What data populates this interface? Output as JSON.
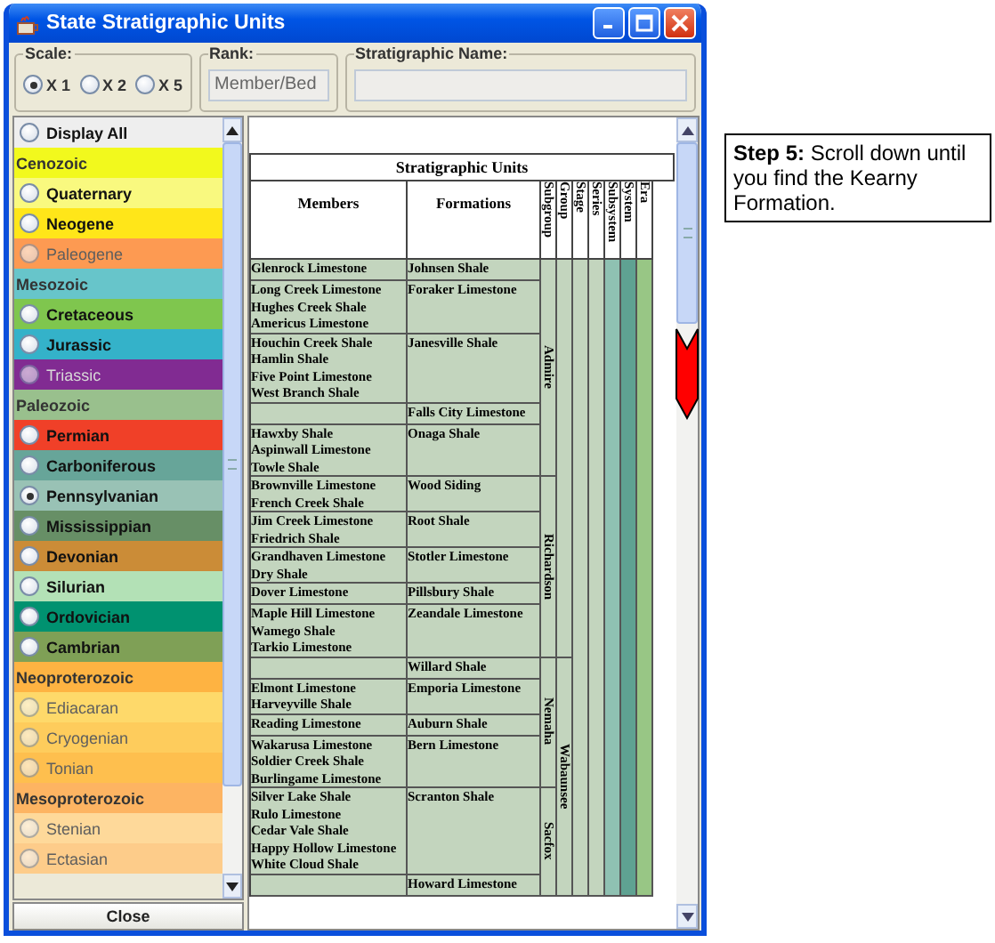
{
  "window": {
    "title": "State Stratigraphic Units"
  },
  "scale": {
    "label": "Scale:",
    "options": [
      {
        "label": "X 1",
        "selected": true
      },
      {
        "label": "X 2",
        "selected": false
      },
      {
        "label": "X 5",
        "selected": false
      }
    ]
  },
  "rank": {
    "label": "Rank:",
    "value": "Member/Bed"
  },
  "strat_name": {
    "label": "Stratigraphic Name:"
  },
  "units_list": [
    {
      "kind": "option",
      "label": "Display All",
      "color": "#eeeeee",
      "selected": false,
      "disabled": false
    },
    {
      "kind": "header",
      "label": "Cenozoic",
      "color": "#f2f91d"
    },
    {
      "kind": "option",
      "label": "Quaternary",
      "color": "#f9f97f",
      "selected": false,
      "disabled": false
    },
    {
      "kind": "option",
      "label": "Neogene",
      "color": "#ffe619",
      "selected": false,
      "disabled": false
    },
    {
      "kind": "option",
      "label": "Paleogene",
      "color": "#fd9a52",
      "selected": false,
      "disabled": true
    },
    {
      "kind": "header",
      "label": "Mesozoic",
      "color": "#67c5ca"
    },
    {
      "kind": "option",
      "label": "Cretaceous",
      "color": "#7fc64e",
      "selected": false,
      "disabled": false
    },
    {
      "kind": "option",
      "label": "Jurassic",
      "color": "#34b2c9",
      "selected": false,
      "disabled": false
    },
    {
      "kind": "option",
      "label": "Triassic",
      "color": "#812b92",
      "selected": false,
      "disabled": true
    },
    {
      "kind": "header",
      "label": "Paleozoic",
      "color": "#99c08d"
    },
    {
      "kind": "option",
      "label": "Permian",
      "color": "#f04028",
      "selected": false,
      "disabled": false
    },
    {
      "kind": "option",
      "label": "Carboniferous",
      "color": "#67a599",
      "selected": false,
      "disabled": false
    },
    {
      "kind": "option",
      "label": "Pennsylvanian",
      "color": "#99c2b5",
      "selected": true,
      "disabled": false
    },
    {
      "kind": "option",
      "label": "Mississippian",
      "color": "#678f66",
      "selected": false,
      "disabled": false
    },
    {
      "kind": "option",
      "label": "Devonian",
      "color": "#cb8c37",
      "selected": false,
      "disabled": false
    },
    {
      "kind": "option",
      "label": "Silurian",
      "color": "#b3e1b6",
      "selected": false,
      "disabled": false
    },
    {
      "kind": "option",
      "label": "Ordovician",
      "color": "#009270",
      "selected": false,
      "disabled": false
    },
    {
      "kind": "option",
      "label": "Cambrian",
      "color": "#7fa056",
      "selected": false,
      "disabled": false
    },
    {
      "kind": "header",
      "label": "Neoproterozoic",
      "color": "#feb342"
    },
    {
      "kind": "option",
      "label": "Ediacaran",
      "color": "#fed96a",
      "selected": false,
      "disabled": true
    },
    {
      "kind": "option",
      "label": "Cryogenian",
      "color": "#fecc5c",
      "selected": false,
      "disabled": true
    },
    {
      "kind": "option",
      "label": "Tonian",
      "color": "#febf4e",
      "selected": false,
      "disabled": true
    },
    {
      "kind": "header",
      "label": "Mesoproterozoic",
      "color": "#fdb462"
    },
    {
      "kind": "option",
      "label": "Stenian",
      "color": "#fed99a",
      "selected": false,
      "disabled": true
    },
    {
      "kind": "option",
      "label": "Ectasian",
      "color": "#fdcc8a",
      "selected": false,
      "disabled": true
    }
  ],
  "close_button": "Close",
  "chart": {
    "title": "Stratigraphic Units",
    "columns": [
      "Members",
      "Formations",
      "Subgroup",
      "Group",
      "Stage",
      "Series",
      "Subsystem",
      "System",
      "Era"
    ],
    "groups": [
      {
        "subgroups": [
          {
            "name": "Admire",
            "formations": [
              {
                "name": "Johnsen Shale",
                "members": [
                  "Glenrock Limestone"
                ]
              },
              {
                "name": "Foraker Limestone",
                "members": [
                  "Long Creek Limestone",
                  "Hughes Creek Shale",
                  "Americus Limestone"
                ]
              },
              {
                "name": "Janesville Shale",
                "members": [
                  "Houchin Creek Shale",
                  "Hamlin Shale",
                  "Five Point Limestone",
                  "West Branch Shale"
                ]
              },
              {
                "name": "Falls City Limestone"
              },
              {
                "name": "Onaga Shale",
                "members": [
                  "Hawxby Shale",
                  "Aspinwall Limestone",
                  "Towle Shale"
                ]
              }
            ]
          },
          {
            "name": "Richardson",
            "formations": [
              {
                "name": "Wood Siding",
                "members": [
                  "Brownville Limestone",
                  "French Creek Shale"
                ]
              },
              {
                "name": "Root Shale",
                "members": [
                  "Jim Creek Limestone",
                  "Friedrich Shale"
                ]
              },
              {
                "name": "Stotler Limestone",
                "members": [
                  "Grandhaven Limestone",
                  "Dry Shale"
                ]
              },
              {
                "name": "Pillsbury Shale",
                "members": [
                  "Dover Limestone"
                ]
              },
              {
                "name": "Zeandale Limestone",
                "members": [
                  "Maple Hill Limestone",
                  "Wamego Shale",
                  "Tarkio Limestone"
                ]
              }
            ]
          }
        ]
      },
      {
        "name": "Wabaunsee",
        "subgroups": [
          {
            "name": "Nemaha",
            "formations": [
              {
                "name": "Willard Shale"
              },
              {
                "name": "Emporia Limestone",
                "members": [
                  "Elmont Limestone",
                  "Harveyville Shale"
                ]
              },
              {
                "name": "Auburn Shale",
                "members": [
                  "Reading Limestone"
                ]
              },
              {
                "name": "Bern Limestone",
                "members": [
                  "Wakarusa Limestone",
                  "Soldier Creek Shale",
                  "Burlingame Limestone"
                ]
              }
            ]
          },
          {
            "name": "Sacfox",
            "formations": [
              {
                "name": "Scranton Shale",
                "members": [
                  "Silver Lake Shale",
                  "Rulo Limestone",
                  "Cedar Vale Shale",
                  "Happy Hollow Limestone",
                  "White Cloud Shale"
                ]
              },
              {
                "name": "Howard Limestone"
              }
            ]
          }
        ]
      }
    ]
  },
  "callout": "**Step 5:** Scroll down until you find the Kearny Formation."
}
